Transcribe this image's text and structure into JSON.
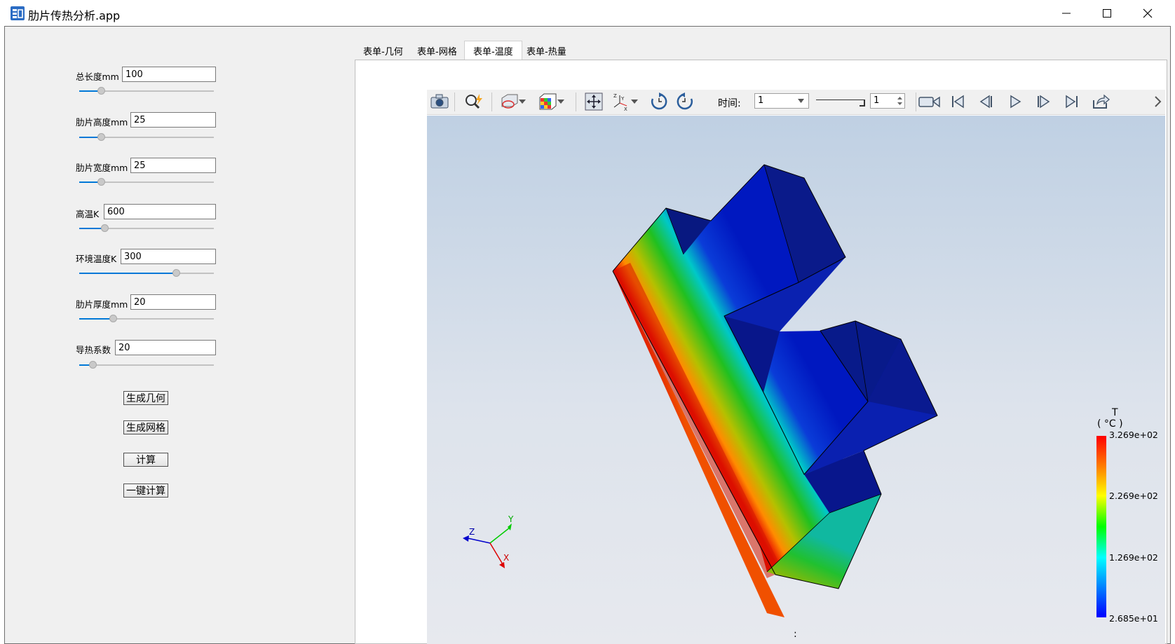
{
  "window": {
    "title": "肋片传热分析.app",
    "controls": [
      "minimize-icon",
      "maximize-icon",
      "close-icon"
    ]
  },
  "params": [
    {
      "label": "总长度mm",
      "value": "100",
      "slider_fraction": 0.16
    },
    {
      "label": "肋片高度mm",
      "value": "25",
      "slider_fraction": 0.16
    },
    {
      "label": "肋片宽度mm",
      "value": "25",
      "slider_fraction": 0.16
    },
    {
      "label": "高温K",
      "value": "600",
      "slider_fraction": 0.19
    },
    {
      "label": "环境温度K",
      "value": "300",
      "slider_fraction": 0.72
    },
    {
      "label": "肋片厚度mm",
      "value": "20",
      "slider_fraction": 0.25
    },
    {
      "label": "导热系数",
      "value": "20",
      "slider_fraction": 0.1
    }
  ],
  "buttons": {
    "gen_geometry": "生成几何",
    "gen_mesh": "生成网格",
    "compute": "计算",
    "one_click": "一键计算"
  },
  "tabs": [
    {
      "label": "表单-几何",
      "active": false
    },
    {
      "label": "表单-网格",
      "active": false
    },
    {
      "label": "表单-温度",
      "active": true
    },
    {
      "label": "表单-热量",
      "active": false
    }
  ],
  "toolbar": {
    "icons": [
      "camera-icon",
      "zoom-icon",
      "view-cube-icon",
      "colormap-icon",
      "fit-icon",
      "axes-icon",
      "rotate-cw-icon",
      "rotate-ccw-icon",
      "record-icon",
      "first-frame-icon",
      "prev-frame-icon",
      "play-icon",
      "next-frame-icon",
      "last-frame-icon",
      "export-icon"
    ],
    "time_label": "时间:",
    "time_value": "1",
    "frame_value": "1"
  },
  "legend": {
    "title_var": "T",
    "title_unit": "( °C )",
    "ticks": [
      "3.269e+02",
      "2.269e+02",
      "1.269e+02",
      "2.685e+01"
    ],
    "colors": [
      "#ff0000",
      "#ff7f00",
      "#ffff00",
      "#00ff00",
      "#00ffff",
      "#0000ff"
    ]
  },
  "axes": {
    "x": "X",
    "y": "Y",
    "z": "Z"
  },
  "viewport_footer": ":"
}
